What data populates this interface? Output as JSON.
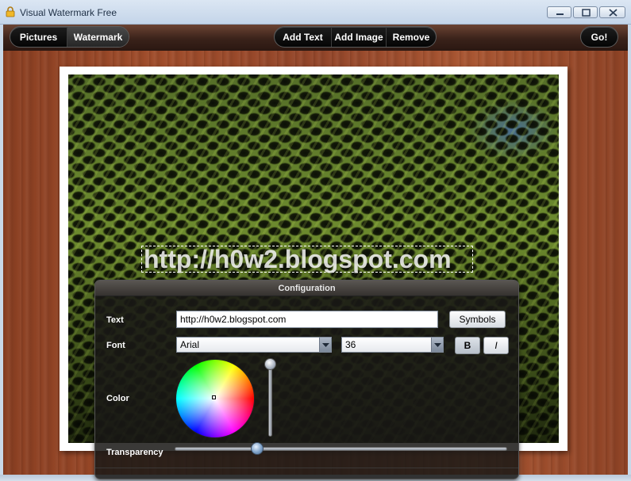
{
  "window": {
    "title": "Visual Watermark Free",
    "icon": "lock-icon",
    "controls": [
      "minimize-icon",
      "maximize-icon",
      "close-icon"
    ]
  },
  "toolbar": {
    "pictures_label": "Pictures",
    "watermark_label": "Watermark",
    "add_text_label": "Add Text",
    "add_image_label": "Add Image",
    "remove_label": "Remove",
    "go_label": "Go!"
  },
  "preview": {
    "watermark_text": "http://h0w2.blogspot.com"
  },
  "config": {
    "title": "Configuration",
    "text_label": "Text",
    "text_value": "http://h0w2.blogspot.com",
    "symbols_label": "Symbols",
    "font_label": "Font",
    "font_value": "Arial",
    "size_value": "36",
    "bold_label": "B",
    "italic_label": "I",
    "color_label": "Color",
    "transparency_label": "Transparency",
    "transparency_level": 0.25,
    "brightness_level": 1.0
  },
  "colors": {
    "toolbar_dark": "#2a1711",
    "wood": "#a04d2b",
    "panel_bg": "#1a1816"
  }
}
